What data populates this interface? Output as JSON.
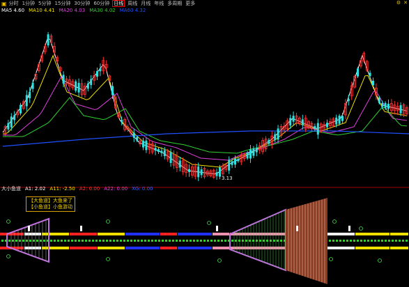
{
  "toolbar": {
    "items": [
      "分时",
      "1分钟",
      "5分钟",
      "15分钟",
      "30分钟",
      "60分钟",
      "日线",
      "周线",
      "月线",
      "年线",
      "多周期",
      "更多"
    ],
    "selected_index": 6,
    "right": [
      "⚙",
      "✕"
    ]
  },
  "main_chart": {
    "legend": [
      {
        "label": "MA5 4.60",
        "color": "#ffffff"
      },
      {
        "label": "MA10 4.41",
        "color": "#f0e000"
      },
      {
        "label": "MA20 4.03",
        "color": "#e040e0"
      },
      {
        "label": "MA30 4.02",
        "color": "#30d030"
      },
      {
        "label": "MA60 4.32",
        "color": "#2050ff"
      }
    ],
    "price_marker": "3.13"
  },
  "sub_chart": {
    "title": "大小鱼道",
    "legend": [
      {
        "label": "A1: 2.02",
        "color": "#ffffff"
      },
      {
        "label": "A11: -2.50",
        "color": "#f0e000"
      },
      {
        "label": "A2: 0.00",
        "color": "#ff3030"
      },
      {
        "label": "A22: 0.00",
        "color": "#e040e0"
      },
      {
        "label": "XG: 0.00",
        "color": "#3060ff"
      }
    ],
    "notes": [
      "【大鱼道】大鱼来了",
      "【小鱼道】小鱼游动"
    ]
  },
  "colors": {
    "up": "#ff3030",
    "down": "#30e0e0",
    "bg": "#000000"
  }
}
